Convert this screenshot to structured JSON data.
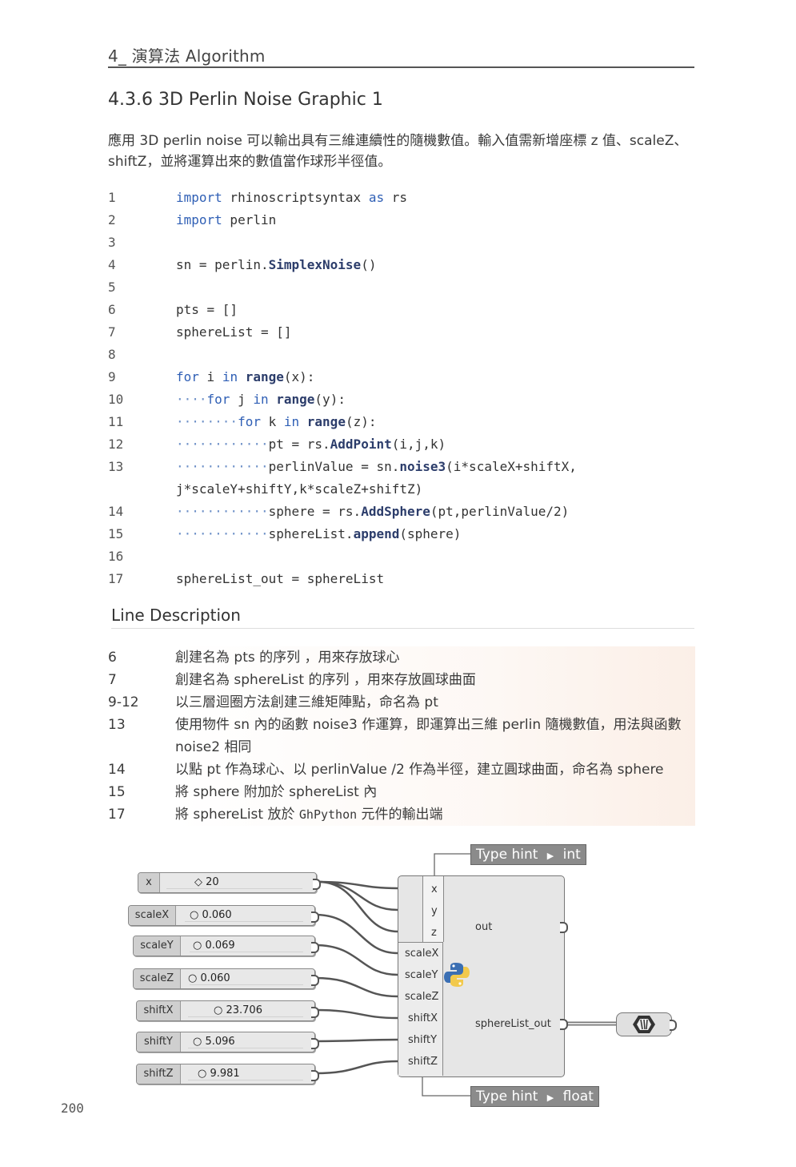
{
  "header": {
    "chapter": "4_ 演算法 Algorithm"
  },
  "section": {
    "title": "4.3.6  3D Perlin Noise Graphic 1"
  },
  "intro": {
    "text": "應用 3D perlin noise 可以輸出具有三維連續性的隨機數值。輸入值需新增座標 z 值、scaleZ、shiftZ，並將運算出來的數值當作球形半徑值。"
  },
  "code": [
    {
      "ln": "1",
      "indent": "",
      "parts": [
        [
          "kw",
          "import"
        ],
        [
          "t",
          " rhinoscriptsyntax "
        ],
        [
          "kw",
          "as"
        ],
        [
          "t",
          " rs"
        ]
      ]
    },
    {
      "ln": "2",
      "indent": "",
      "parts": [
        [
          "kw",
          "import"
        ],
        [
          "t",
          " perlin"
        ]
      ]
    },
    {
      "ln": "3",
      "indent": "",
      "parts": []
    },
    {
      "ln": "4",
      "indent": "",
      "parts": [
        [
          "t",
          "sn = perlin."
        ],
        [
          "fn",
          "SimplexNoise"
        ],
        [
          "t",
          "()"
        ]
      ]
    },
    {
      "ln": "5",
      "indent": "",
      "parts": []
    },
    {
      "ln": "6",
      "indent": "",
      "parts": [
        [
          "t",
          "pts = []"
        ]
      ]
    },
    {
      "ln": "7",
      "indent": "",
      "parts": [
        [
          "t",
          "sphereList = []"
        ]
      ]
    },
    {
      "ln": "8",
      "indent": "",
      "parts": []
    },
    {
      "ln": "9",
      "indent": "",
      "parts": [
        [
          "kw",
          "for"
        ],
        [
          "t",
          " i "
        ],
        [
          "kw",
          "in"
        ],
        [
          "t",
          " "
        ],
        [
          "fn",
          "range"
        ],
        [
          "t",
          "(x):"
        ]
      ]
    },
    {
      "ln": "10",
      "indent": "····",
      "parts": [
        [
          "kw",
          "for"
        ],
        [
          "t",
          " j "
        ],
        [
          "kw",
          "in"
        ],
        [
          "t",
          " "
        ],
        [
          "fn",
          "range"
        ],
        [
          "t",
          "(y):"
        ]
      ]
    },
    {
      "ln": "11",
      "indent": "········",
      "parts": [
        [
          "kw",
          "for"
        ],
        [
          "t",
          " k "
        ],
        [
          "kw",
          "in"
        ],
        [
          "t",
          " "
        ],
        [
          "fn",
          "range"
        ],
        [
          "t",
          "(z):"
        ]
      ]
    },
    {
      "ln": "12",
      "indent": "············",
      "parts": [
        [
          "t",
          "pt = rs."
        ],
        [
          "fn",
          "AddPoint"
        ],
        [
          "t",
          "(i,j,k)"
        ]
      ]
    },
    {
      "ln": "13",
      "indent": "············",
      "parts": [
        [
          "t",
          "perlinValue = sn."
        ],
        [
          "fn",
          "noise3"
        ],
        [
          "t",
          "(i*scaleX+shiftX,"
        ]
      ]
    },
    {
      "ln": "",
      "indent": "",
      "parts": [
        [
          "t",
          "j*scaleY+shiftY,k*scaleZ+shiftZ)"
        ]
      ]
    },
    {
      "ln": "14",
      "indent": "············",
      "parts": [
        [
          "t",
          "sphere = rs."
        ],
        [
          "fn",
          "AddSphere"
        ],
        [
          "t",
          "(pt,perlinValue/2)"
        ]
      ]
    },
    {
      "ln": "15",
      "indent": "············",
      "parts": [
        [
          "t",
          "sphereList."
        ],
        [
          "fn",
          "append"
        ],
        [
          "t",
          "(sphere)"
        ]
      ]
    },
    {
      "ln": "16",
      "indent": "",
      "parts": []
    },
    {
      "ln": "17",
      "indent": "",
      "parts": [
        [
          "t",
          "sphereList_out = sphereList"
        ]
      ]
    }
  ],
  "line_description": {
    "title": "Line Description",
    "rows": [
      {
        "ln": "6",
        "text": "創建名為 pts 的序列 ，用來存放球心"
      },
      {
        "ln": "7",
        "text": "創建名為 sphereList 的序列 ，用來存放圓球曲面"
      },
      {
        "ln": "9-12",
        "text": "以三層迴圈方法創建三維矩陣點，命名為 pt"
      },
      {
        "ln": "13",
        "text": "使用物件 sn 內的函數 noise3 作運算，即運算出三維 perlin 隨機數值，用法與函數 noise2 相同"
      },
      {
        "ln": "14",
        "text": "以點 pt 作為球心、以 perlinValue /2 作為半徑，建立圓球曲面，命名為 sphere"
      },
      {
        "ln": "15",
        "text": "將 sphere 附加於 sphereList 內"
      },
      {
        "ln": "17",
        "text_pre": "將 sphereList 放於 ",
        "text_mono": "GhPython",
        "text_post": " 元件的輸出端"
      }
    ]
  },
  "diagram": {
    "sliders": [
      {
        "label": "x",
        "value": "◇ 20"
      },
      {
        "label": "scaleX",
        "value": "○ 0.060"
      },
      {
        "label": "scaleY",
        "value": "○ 0.069"
      },
      {
        "label": "scaleZ",
        "value": "○ 0.060"
      },
      {
        "label": "shiftX",
        "value": "○ 23.706"
      },
      {
        "label": "shiftY",
        "value": "○ 5.096"
      },
      {
        "label": "shiftZ",
        "value": "○ 9.981"
      }
    ],
    "inputs": [
      "x",
      "y",
      "z",
      "scaleX",
      "scaleY",
      "scaleZ",
      "shiftX",
      "shiftY",
      "shiftZ"
    ],
    "outputs": [
      "out",
      "sphereList_out"
    ],
    "type_hint_top": {
      "label": "Type hint",
      "value": "int"
    },
    "type_hint_bottom": {
      "label": "Type hint",
      "value": "float"
    },
    "python_icon": "python-icon",
    "geometry_icon": "geometry-param-icon"
  },
  "page_number": "200"
}
